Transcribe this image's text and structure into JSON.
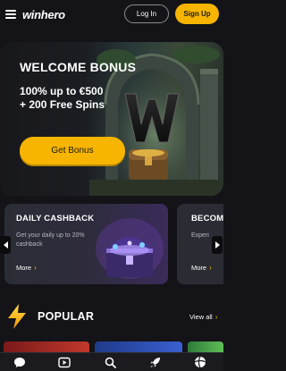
{
  "header": {
    "menu_icon": "hamburger-menu-icon",
    "logo_text": "winhero",
    "login_label": "Log In",
    "signup_label": "Sign Up"
  },
  "hero": {
    "title": "WELCOME BONUS",
    "line1": "100% up to €500",
    "line2": "+ 200 Free Spins",
    "button_label": "Get Bonus"
  },
  "promos": [
    {
      "title": "DAILY CASHBACK",
      "description": "Get your daily up to 20% cashback",
      "more_label": "More"
    },
    {
      "title": "BECOM",
      "description": "Experi",
      "more_label": "More"
    }
  ],
  "popular": {
    "title": "POPULAR",
    "view_all_label": "View all"
  },
  "bottom_nav": {
    "items": [
      {
        "icon": "chat-bubble-icon"
      },
      {
        "icon": "play-icon"
      },
      {
        "icon": "search-icon"
      },
      {
        "icon": "rocket-icon"
      },
      {
        "icon": "sports-ball-icon"
      }
    ]
  },
  "colors": {
    "accent": "#f7b500",
    "background": "#141418",
    "card": "#2b2c33"
  }
}
